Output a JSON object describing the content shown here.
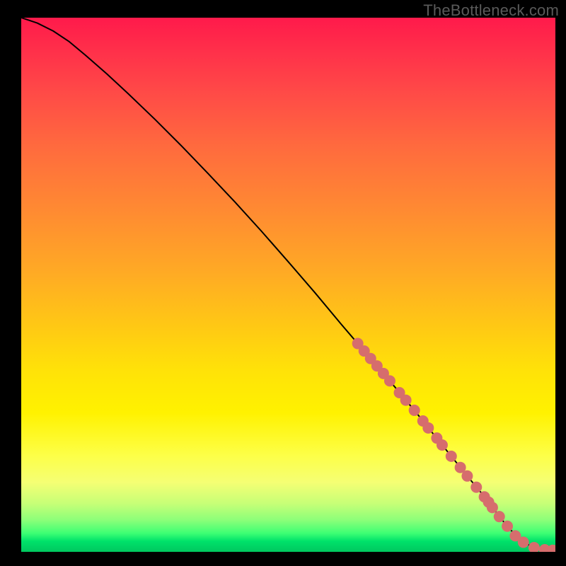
{
  "watermark": "TheBottleneck.com",
  "chart_data": {
    "type": "line",
    "xlim": [
      0,
      100
    ],
    "ylim": [
      0,
      100
    ],
    "title": "",
    "xlabel": "",
    "ylabel": "",
    "series": [
      {
        "name": "bottleneck-curve",
        "color": "#000000",
        "x": [
          0,
          3,
          6,
          9,
          12,
          16,
          20,
          25,
          30,
          35,
          40,
          45,
          50,
          55,
          60,
          63,
          66,
          70,
          74,
          78,
          81,
          84,
          87,
          89,
          90,
          92,
          94,
          96,
          98,
          100
        ],
        "values": [
          100,
          99,
          97.5,
          95.5,
          93,
          89.5,
          85.8,
          81,
          76,
          70.8,
          65.5,
          60,
          54.3,
          48.5,
          42.5,
          39,
          35.5,
          30.8,
          26,
          21,
          17.3,
          13.6,
          10,
          7.3,
          6,
          3.7,
          1.8,
          0.8,
          0.4,
          0.3
        ]
      }
    ],
    "markers": {
      "name": "highlighted-points",
      "color": "#d66d6d",
      "radius": 8,
      "points": [
        {
          "x": 63.0,
          "y": 39.0
        },
        {
          "x": 64.2,
          "y": 37.6
        },
        {
          "x": 65.4,
          "y": 36.2
        },
        {
          "x": 66.6,
          "y": 34.8
        },
        {
          "x": 67.8,
          "y": 33.4
        },
        {
          "x": 69.0,
          "y": 32.0
        },
        {
          "x": 70.8,
          "y": 29.8
        },
        {
          "x": 72.0,
          "y": 28.4
        },
        {
          "x": 73.6,
          "y": 26.5
        },
        {
          "x": 75.2,
          "y": 24.5
        },
        {
          "x": 76.2,
          "y": 23.2
        },
        {
          "x": 77.8,
          "y": 21.3
        },
        {
          "x": 78.8,
          "y": 20.0
        },
        {
          "x": 80.5,
          "y": 17.9
        },
        {
          "x": 82.2,
          "y": 15.8
        },
        {
          "x": 83.5,
          "y": 14.2
        },
        {
          "x": 85.2,
          "y": 12.1
        },
        {
          "x": 86.7,
          "y": 10.3
        },
        {
          "x": 87.5,
          "y": 9.3
        },
        {
          "x": 88.2,
          "y": 8.3
        },
        {
          "x": 89.5,
          "y": 6.6
        },
        {
          "x": 91.0,
          "y": 4.8
        },
        {
          "x": 92.5,
          "y": 3.0
        },
        {
          "x": 94.0,
          "y": 1.8
        },
        {
          "x": 96.0,
          "y": 0.8
        },
        {
          "x": 98.0,
          "y": 0.4
        },
        {
          "x": 99.5,
          "y": 0.3
        }
      ]
    }
  }
}
